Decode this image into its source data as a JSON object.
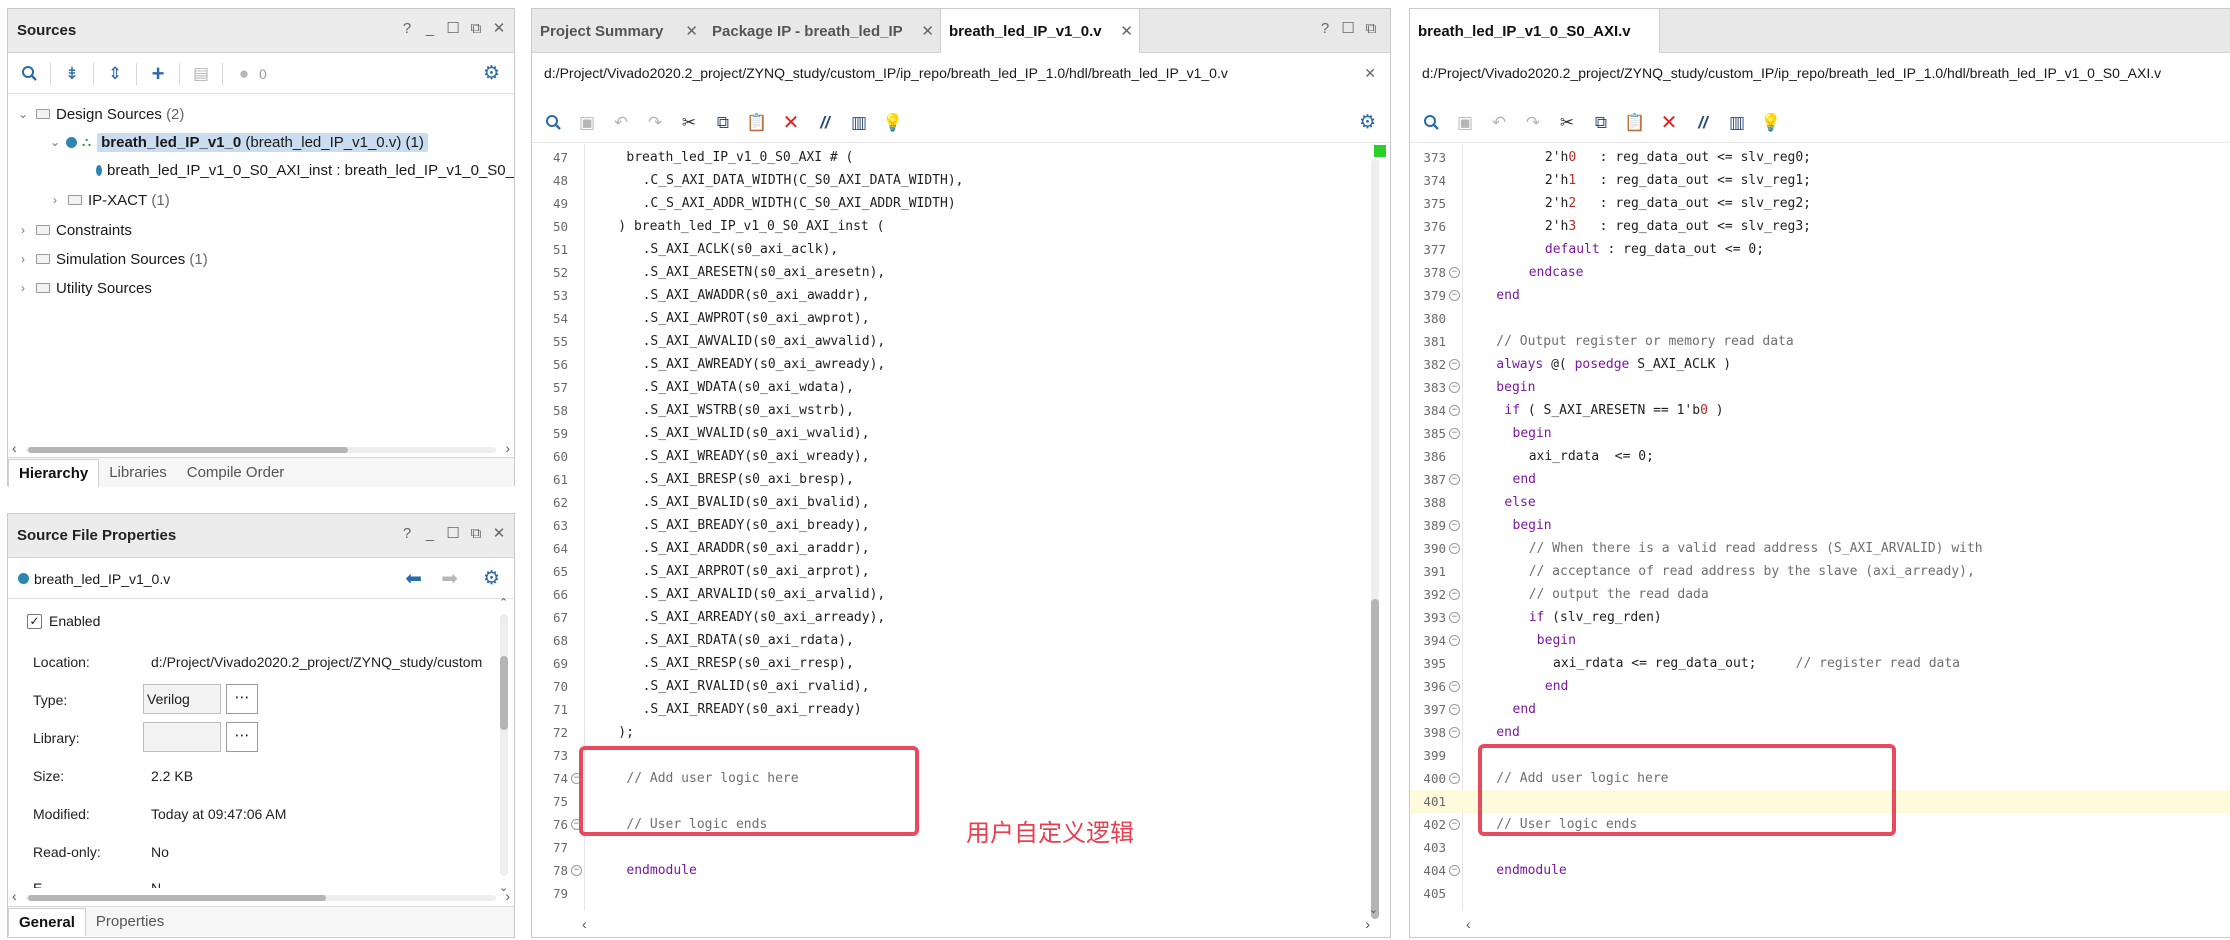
{
  "sources_panel": {
    "title": "Sources",
    "toolbar_count": "0",
    "tree": {
      "design_sources_label": "Design Sources",
      "design_sources_count": "(2)",
      "top_module_name": "breath_led_IP_v1_0",
      "top_module_file": "(breath_led_IP_v1_0.v)",
      "top_module_count": "(1)",
      "child_instance": "breath_led_IP_v1_0_S0_AXI_inst : breath_led_IP_v1_0_S0_",
      "ipxact_label": "IP-XACT",
      "ipxact_count": "(1)",
      "constraints_label": "Constraints",
      "simulation_label": "Simulation Sources",
      "simulation_count": "(1)",
      "utility_label": "Utility Sources"
    },
    "tabs": [
      "Hierarchy",
      "Libraries",
      "Compile Order"
    ]
  },
  "properties_panel": {
    "title": "Source File Properties",
    "file": "breath_led_IP_v1_0.v",
    "enabled_label": "Enabled",
    "rows": {
      "location_label": "Location:",
      "location_value": "d:/Project/Vivado2020.2_project/ZYNQ_study/custom",
      "type_label": "Type:",
      "type_value": "Verilog",
      "library_label": "Library:",
      "library_value": "",
      "size_label": "Size:",
      "size_value": "2.2 KB",
      "modified_label": "Modified:",
      "modified_value": "Today at 09:47:06 AM",
      "readonly_label": "Read-only:",
      "readonly_value": "No",
      "cut_label": "E",
      "cut_value": "N"
    },
    "tabs": [
      "General",
      "Properties"
    ]
  },
  "editor_left": {
    "tabs": [
      "Project Summary",
      "Package IP - breath_led_IP",
      "breath_led_IP_v1_0.v"
    ],
    "path": "d:/Project/Vivado2020.2_project/ZYNQ_study/custom_IP/ip_repo/breath_led_IP_1.0/hdl/breath_led_IP_v1_0.v",
    "lines": [
      {
        "n": "47",
        "indent": 4,
        "parts": [
          [
            "breath_led_IP_v1_0_S0_AXI # (",
            ""
          ]
        ]
      },
      {
        "n": "48",
        "indent": 6,
        "parts": [
          [
            ".C_S_AXI_DATA_WIDTH(C_S0_AXI_DATA_WIDTH),",
            ""
          ]
        ]
      },
      {
        "n": "49",
        "indent": 6,
        "parts": [
          [
            ".C_S_AXI_ADDR_WIDTH(C_S0_AXI_ADDR_WIDTH)",
            ""
          ]
        ]
      },
      {
        "n": "50",
        "indent": 3,
        "parts": [
          [
            ") breath_led_IP_v1_0_S0_AXI_inst (",
            ""
          ]
        ]
      },
      {
        "n": "51",
        "indent": 6,
        "parts": [
          [
            ".S_AXI_ACLK(s0_axi_aclk),",
            ""
          ]
        ]
      },
      {
        "n": "52",
        "indent": 6,
        "parts": [
          [
            ".S_AXI_ARESETN(s0_axi_aresetn),",
            ""
          ]
        ]
      },
      {
        "n": "53",
        "indent": 6,
        "parts": [
          [
            ".S_AXI_AWADDR(s0_axi_awaddr),",
            ""
          ]
        ]
      },
      {
        "n": "54",
        "indent": 6,
        "parts": [
          [
            ".S_AXI_AWPROT(s0_axi_awprot),",
            ""
          ]
        ]
      },
      {
        "n": "55",
        "indent": 6,
        "parts": [
          [
            ".S_AXI_AWVALID(s0_axi_awvalid),",
            ""
          ]
        ]
      },
      {
        "n": "56",
        "indent": 6,
        "parts": [
          [
            ".S_AXI_AWREADY(s0_axi_awready),",
            ""
          ]
        ]
      },
      {
        "n": "57",
        "indent": 6,
        "parts": [
          [
            ".S_AXI_WDATA(s0_axi_wdata),",
            ""
          ]
        ]
      },
      {
        "n": "58",
        "indent": 6,
        "parts": [
          [
            ".S_AXI_WSTRB(s0_axi_wstrb),",
            ""
          ]
        ]
      },
      {
        "n": "59",
        "indent": 6,
        "parts": [
          [
            ".S_AXI_WVALID(s0_axi_wvalid),",
            ""
          ]
        ]
      },
      {
        "n": "60",
        "indent": 6,
        "parts": [
          [
            ".S_AXI_WREADY(s0_axi_wready),",
            ""
          ]
        ]
      },
      {
        "n": "61",
        "indent": 6,
        "parts": [
          [
            ".S_AXI_BRESP(s0_axi_bresp),",
            ""
          ]
        ]
      },
      {
        "n": "62",
        "indent": 6,
        "parts": [
          [
            ".S_AXI_BVALID(s0_axi_bvalid),",
            ""
          ]
        ]
      },
      {
        "n": "63",
        "indent": 6,
        "parts": [
          [
            ".S_AXI_BREADY(s0_axi_bready),",
            ""
          ]
        ]
      },
      {
        "n": "64",
        "indent": 6,
        "parts": [
          [
            ".S_AXI_ARADDR(s0_axi_araddr),",
            ""
          ]
        ]
      },
      {
        "n": "65",
        "indent": 6,
        "parts": [
          [
            ".S_AXI_ARPROT(s0_axi_arprot),",
            ""
          ]
        ]
      },
      {
        "n": "66",
        "indent": 6,
        "parts": [
          [
            ".S_AXI_ARVALID(s0_axi_arvalid),",
            ""
          ]
        ]
      },
      {
        "n": "67",
        "indent": 6,
        "parts": [
          [
            ".S_AXI_ARREADY(s0_axi_arready),",
            ""
          ]
        ]
      },
      {
        "n": "68",
        "indent": 6,
        "parts": [
          [
            ".S_AXI_RDATA(s0_axi_rdata),",
            ""
          ]
        ]
      },
      {
        "n": "69",
        "indent": 6,
        "parts": [
          [
            ".S_AXI_RRESP(s0_axi_rresp),",
            ""
          ]
        ]
      },
      {
        "n": "70",
        "indent": 6,
        "parts": [
          [
            ".S_AXI_RVALID(s0_axi_rvalid),",
            ""
          ]
        ]
      },
      {
        "n": "71",
        "indent": 6,
        "parts": [
          [
            ".S_AXI_RREADY(s0_axi_rready)",
            ""
          ]
        ]
      },
      {
        "n": "72",
        "indent": 3,
        "parts": [
          [
            ");",
            ""
          ]
        ]
      },
      {
        "n": "73",
        "indent": 0,
        "parts": []
      },
      {
        "n": "74",
        "indent": 4,
        "fold": true,
        "parts": [
          [
            "// Add user logic here",
            "cm"
          ]
        ]
      },
      {
        "n": "75",
        "indent": 0,
        "parts": []
      },
      {
        "n": "76",
        "indent": 4,
        "fold": true,
        "parts": [
          [
            "// User logic ends",
            "cm"
          ]
        ]
      },
      {
        "n": "77",
        "indent": 0,
        "parts": []
      },
      {
        "n": "78",
        "indent": 4,
        "fold": true,
        "parts": [
          [
            "endmodule",
            "kw"
          ]
        ]
      },
      {
        "n": "79",
        "indent": 0,
        "parts": []
      }
    ],
    "annotation": "用户自定义逻辑"
  },
  "editor_right": {
    "tab": "breath_led_IP_v1_0_S0_AXI.v",
    "path": "d:/Project/Vivado2020.2_project/ZYNQ_study/custom_IP/ip_repo/breath_led_IP_1.0/hdl/breath_led_IP_v1_0_S0_AXI.v",
    "lines": [
      {
        "n": "373",
        "indent": 9,
        "parts": [
          [
            "2'h",
            ""
          ],
          [
            "0",
            "nm"
          ],
          [
            "   : reg_data_out <= slv_reg0;",
            ""
          ]
        ]
      },
      {
        "n": "374",
        "indent": 9,
        "parts": [
          [
            "2'h",
            ""
          ],
          [
            "1",
            "nm"
          ],
          [
            "   : reg_data_out <= slv_reg1;",
            ""
          ]
        ]
      },
      {
        "n": "375",
        "indent": 9,
        "parts": [
          [
            "2'h",
            ""
          ],
          [
            "2",
            "nm"
          ],
          [
            "   : reg_data_out <= slv_reg2;",
            ""
          ]
        ]
      },
      {
        "n": "376",
        "indent": 9,
        "parts": [
          [
            "2'h",
            ""
          ],
          [
            "3",
            "nm"
          ],
          [
            "   : reg_data_out <= slv_reg3;",
            ""
          ]
        ]
      },
      {
        "n": "377",
        "indent": 9,
        "parts": [
          [
            "default",
            "kw"
          ],
          [
            " : reg_data_out <= 0;",
            ""
          ]
        ]
      },
      {
        "n": "378",
        "indent": 7,
        "fold": true,
        "parts": [
          [
            "endcase",
            "kw"
          ]
        ]
      },
      {
        "n": "379",
        "indent": 3,
        "fold": true,
        "parts": [
          [
            "end",
            "kw"
          ]
        ]
      },
      {
        "n": "380",
        "indent": 0,
        "parts": []
      },
      {
        "n": "381",
        "indent": 3,
        "parts": [
          [
            "// Output register or memory read data",
            "cm"
          ]
        ]
      },
      {
        "n": "382",
        "indent": 3,
        "fold": true,
        "parts": [
          [
            "always",
            "kw"
          ],
          [
            " @( ",
            ""
          ],
          [
            "posedge",
            "kw"
          ],
          [
            " S_AXI_ACLK )",
            ""
          ]
        ]
      },
      {
        "n": "383",
        "indent": 3,
        "fold": true,
        "parts": [
          [
            "begin",
            "kw"
          ]
        ]
      },
      {
        "n": "384",
        "indent": 4,
        "fold": true,
        "parts": [
          [
            "if",
            "kw"
          ],
          [
            " ( S_AXI_ARESETN == 1'b",
            ""
          ],
          [
            "0",
            "nm"
          ],
          [
            " )",
            ""
          ]
        ]
      },
      {
        "n": "385",
        "indent": 5,
        "fold": true,
        "parts": [
          [
            "begin",
            "kw"
          ]
        ]
      },
      {
        "n": "386",
        "indent": 7,
        "parts": [
          [
            "axi_rdata  <= 0;",
            ""
          ]
        ]
      },
      {
        "n": "387",
        "indent": 5,
        "fold": true,
        "parts": [
          [
            "end",
            "kw"
          ]
        ]
      },
      {
        "n": "388",
        "indent": 4,
        "parts": [
          [
            "else",
            "kw"
          ]
        ]
      },
      {
        "n": "389",
        "indent": 5,
        "fold": true,
        "parts": [
          [
            "begin",
            "kw"
          ]
        ]
      },
      {
        "n": "390",
        "indent": 7,
        "fold": true,
        "parts": [
          [
            "// When there is a valid read address (S_AXI_ARVALID) with",
            "cm"
          ]
        ]
      },
      {
        "n": "391",
        "indent": 7,
        "parts": [
          [
            "// acceptance of read address by the slave (axi_arready),",
            "cm"
          ]
        ]
      },
      {
        "n": "392",
        "indent": 7,
        "fold": true,
        "parts": [
          [
            "// output the read dada",
            "cm"
          ]
        ]
      },
      {
        "n": "393",
        "indent": 7,
        "fold": true,
        "parts": [
          [
            "if",
            "kw"
          ],
          [
            " (slv_reg_rden)",
            ""
          ]
        ]
      },
      {
        "n": "394",
        "indent": 8,
        "fold": true,
        "parts": [
          [
            "begin",
            "kw"
          ]
        ]
      },
      {
        "n": "395",
        "indent": 10,
        "parts": [
          [
            "axi_rdata <= reg_data_out;     ",
            ""
          ],
          [
            "// register read data",
            "cm"
          ]
        ]
      },
      {
        "n": "396",
        "indent": 9,
        "fold": true,
        "parts": [
          [
            "end",
            "kw"
          ]
        ]
      },
      {
        "n": "397",
        "indent": 5,
        "fold": true,
        "parts": [
          [
            "end",
            "kw"
          ]
        ]
      },
      {
        "n": "398",
        "indent": 3,
        "fold": true,
        "parts": [
          [
            "end",
            "kw"
          ]
        ]
      },
      {
        "n": "399",
        "indent": 0,
        "parts": []
      },
      {
        "n": "400",
        "indent": 3,
        "fold": true,
        "parts": [
          [
            "// Add user logic here",
            "cm"
          ]
        ]
      },
      {
        "n": "401",
        "indent": 0,
        "highlight": true,
        "parts": []
      },
      {
        "n": "402",
        "indent": 3,
        "fold": true,
        "parts": [
          [
            "// User logic ends",
            "cm"
          ]
        ]
      },
      {
        "n": "403",
        "indent": 0,
        "parts": []
      },
      {
        "n": "404",
        "indent": 3,
        "fold": true,
        "parts": [
          [
            "endmodule",
            "kw"
          ]
        ]
      },
      {
        "n": "405",
        "indent": 0,
        "parts": []
      }
    ]
  },
  "colors": {
    "accent_blue": "#2a6aa8",
    "annotation_red": "#e7495d",
    "selection": "#c9dcf0",
    "keyword": "#7a1aa0",
    "comment": "#6f6f6f"
  }
}
